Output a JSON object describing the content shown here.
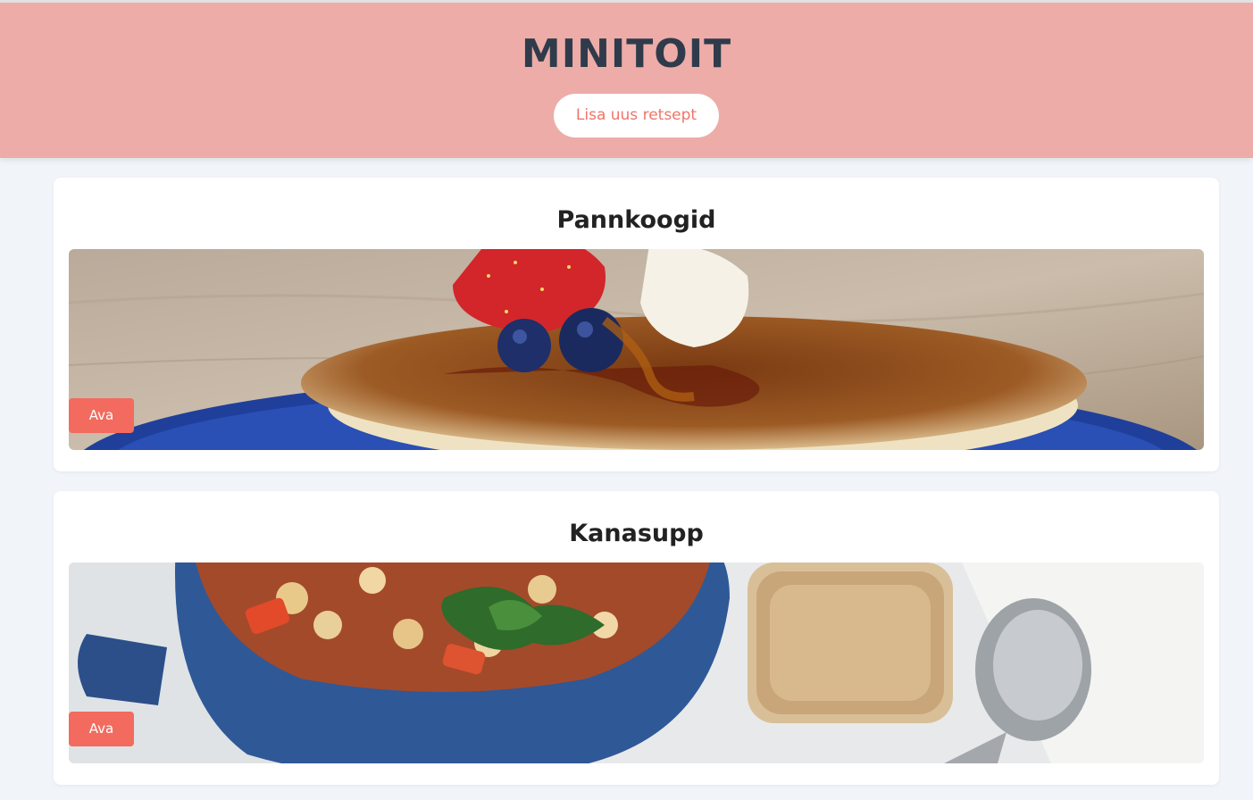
{
  "header": {
    "title": "MINITOIT",
    "add_recipe_label": "Lisa uus retsept"
  },
  "recipes": [
    {
      "title": "Pannkoogid",
      "image_icon": "pancakes-photo",
      "open_label": "Ava"
    },
    {
      "title": "Kanasupp",
      "image_icon": "soup-photo",
      "open_label": "Ava"
    }
  ],
  "colors": {
    "header_bg": "#edaca8",
    "title_text": "#2f3b4b",
    "accent": "#f26b5e",
    "page_bg": "#f1f5f9"
  }
}
